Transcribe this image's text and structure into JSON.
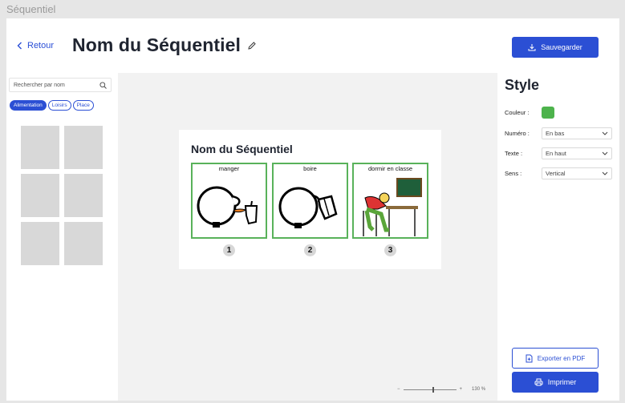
{
  "window": {
    "title": "Séquentiel"
  },
  "header": {
    "back_label": "Retour",
    "title": "Nom du Séquentiel",
    "save_label": "Sauvegarder"
  },
  "library": {
    "search_placeholder": "Rechercher par nom",
    "filters": [
      {
        "label": "Alimentation",
        "active": true
      },
      {
        "label": "Loisirs",
        "active": false
      },
      {
        "label": "Place",
        "active": false
      }
    ],
    "thumbnails": 6
  },
  "sheet": {
    "title": "Nom du Séquentiel",
    "steps": [
      {
        "label": "manger",
        "number": "1",
        "icon": "eating-pictogram"
      },
      {
        "label": "boire",
        "number": "2",
        "icon": "drinking-pictogram"
      },
      {
        "label": "dormir en classe",
        "number": "3",
        "icon": "sleeping-in-class-pictogram"
      }
    ]
  },
  "zoom": {
    "minus": "−",
    "plus": "+",
    "value": "130 %",
    "level": 0.55
  },
  "style_panel": {
    "title": "Style",
    "color_label": "Couleur :",
    "color_value": "#4db34c",
    "number_label": "Numéro :",
    "number_value": "En bas",
    "text_label": "Texte :",
    "text_value": "En haut",
    "direction_label": "Sens :",
    "direction_value": "Vertical",
    "export_label": "Exporter en PDF",
    "print_label": "Imprimer"
  },
  "colors": {
    "accent": "#2b4fd4",
    "step_border": "#59b25a"
  }
}
